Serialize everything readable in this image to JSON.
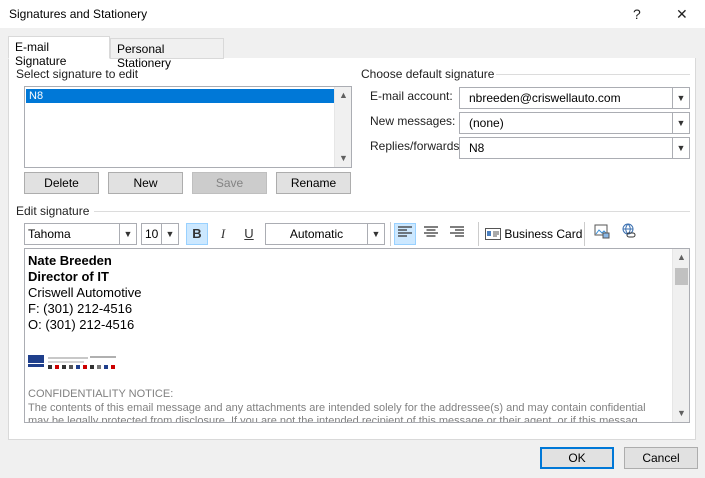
{
  "window": {
    "title": "Signatures and Stationery",
    "help_label": "?",
    "close_label": "✕"
  },
  "tabs": [
    {
      "label": "E-mail Signature",
      "active": true
    },
    {
      "label": "Personal Stationery",
      "active": false
    }
  ],
  "select_signature": {
    "label": "Select signature to edit",
    "items": [
      "N8"
    ],
    "selected": "N8"
  },
  "signature_buttons": {
    "delete": "Delete",
    "new": "New",
    "save": "Save",
    "rename": "Rename"
  },
  "default_signature": {
    "label": "Choose default signature",
    "email_account_label": "E-mail account:",
    "email_account_value": "nbreeden@criswellauto.com",
    "new_messages_label": "New messages:",
    "new_messages_value": "(none)",
    "replies_label": "Replies/forwards:",
    "replies_value": "N8"
  },
  "edit_signature": {
    "label": "Edit signature",
    "font": "Tahoma",
    "size": "10",
    "bold": "B",
    "italic": "I",
    "underline": "U",
    "color": "Automatic",
    "business_card": "Business Card"
  },
  "signature_content": {
    "name": "Nate Breeden",
    "title": "Director of IT",
    "company": "Criswell Automotive",
    "fax": "F: (301) 212-4516",
    "office": "O: (301) 212-4516",
    "notice_heading": "CONFIDENTIALITY NOTICE:",
    "notice_line1": "The contents of this email message and any attachments are intended solely for the addressee(s) and may contain confidential",
    "notice_line2": "may be legally protected from disclosure. If you are not the intended recipient of this message or their agent, or if this messag"
  },
  "dialog_buttons": {
    "ok": "OK",
    "cancel": "Cancel"
  },
  "colors": {
    "accent": "#0078d7",
    "highlight": "#cce8ff"
  }
}
